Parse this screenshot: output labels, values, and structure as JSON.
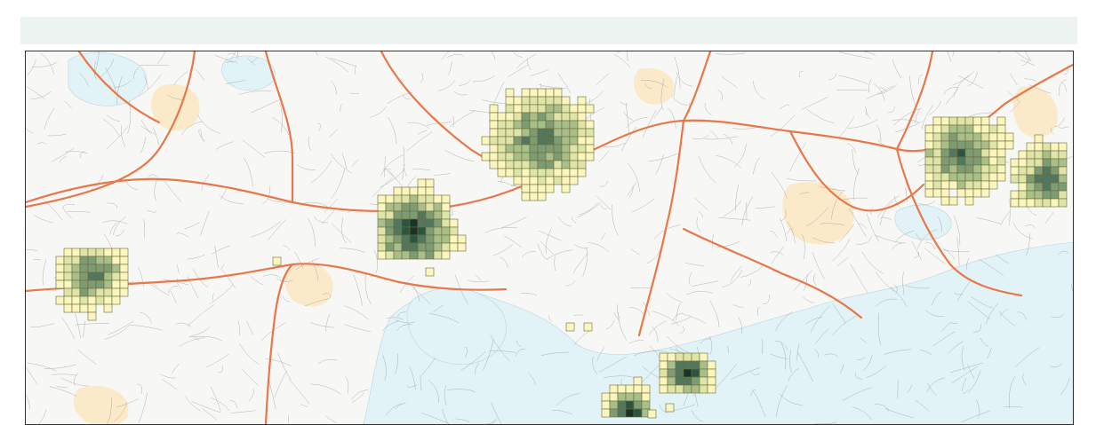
{
  "header": {
    "title": ""
  },
  "map": {
    "legend_title": "",
    "colors": {
      "land": "#f7f7f5",
      "water": "#e4f4f8",
      "lake": "#dff1f6",
      "park": "#fbe9c4",
      "road": "#6f6f6f",
      "highway": "#e8774a",
      "grid_border": "#6b6b3a"
    },
    "density_scale": [
      "#fbf6bf",
      "#dfe5a8",
      "#a9bf8a",
      "#7d9c74",
      "#52775f",
      "#2c5443",
      "#163526"
    ]
  }
}
